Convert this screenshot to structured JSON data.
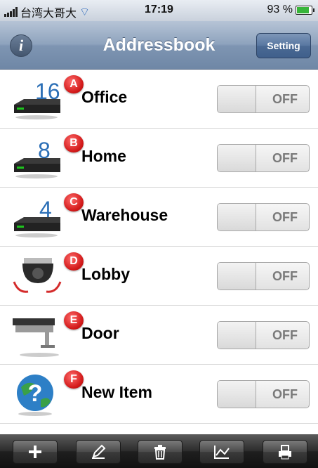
{
  "status_bar": {
    "carrier": "台湾大哥大",
    "time": "17:19",
    "battery": "93 %"
  },
  "nav": {
    "title": "Addressbook",
    "info_glyph": "i",
    "setting_label": "Setting"
  },
  "items": [
    {
      "badge": "A",
      "name": "Office",
      "switch": "OFF",
      "icon": "dvr-16-channel-icon",
      "channels": "16"
    },
    {
      "badge": "B",
      "name": "Home",
      "switch": "OFF",
      "icon": "dvr-8-channel-icon",
      "channels": "8"
    },
    {
      "badge": "C",
      "name": "Warehouse",
      "switch": "OFF",
      "icon": "dvr-4-channel-icon",
      "channels": "4"
    },
    {
      "badge": "D",
      "name": "Lobby",
      "switch": "OFF",
      "icon": "dome-camera-icon"
    },
    {
      "badge": "E",
      "name": "Door",
      "switch": "OFF",
      "icon": "bullet-camera-icon"
    },
    {
      "badge": "F",
      "name": "New Item",
      "switch": "OFF",
      "icon": "help-globe-icon"
    }
  ],
  "toolbar": [
    "add-icon",
    "edit-pencil-icon",
    "trash-icon",
    "chart-icon",
    "print-icon"
  ],
  "colors": {
    "badge": "#d21919",
    "navbar": "#7e95b2",
    "battery": "#37b53a"
  }
}
